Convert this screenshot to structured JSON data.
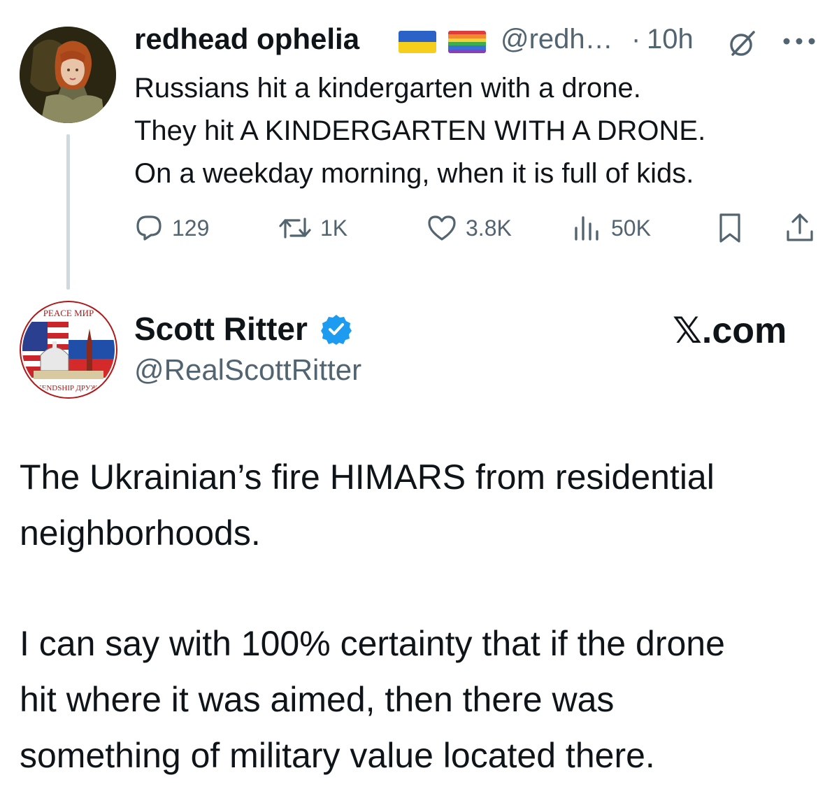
{
  "parent_tweet": {
    "display_name": "redhead ophelia",
    "flags": [
      "ukraine-flag",
      "pride-flag"
    ],
    "handle": "@redh…",
    "separator": "·",
    "time": "10h",
    "lines": [
      "Russians hit a kindergarten with a drone.",
      "They hit A KINDERGARTEN WITH A DRONE.",
      "On a weekday morning, when it is full of kids."
    ],
    "stats": {
      "replies": "129",
      "retweets": "1K",
      "likes": "3.8K",
      "views": "50K"
    }
  },
  "main_tweet": {
    "display_name": "Scott Ritter",
    "verified": true,
    "handle": "@RealScottRitter",
    "source": "𝕏.com",
    "avatar": {
      "top_text": "PEACE МИР",
      "bottom_text": "FRIENDSHIP ДРУЖБА"
    },
    "paragraphs": [
      [
        "The Ukrainian’s fire HIMARS from residential",
        "neighborhoods."
      ],
      [
        "I can say with 100% certainty that if the drone",
        "hit where it was aimed, then there was",
        "something of military value located there."
      ]
    ]
  },
  "colors": {
    "text": "#0f1419",
    "secondary": "#536471",
    "verified": "#1d9bf0",
    "thread_line": "#cfd9de"
  }
}
